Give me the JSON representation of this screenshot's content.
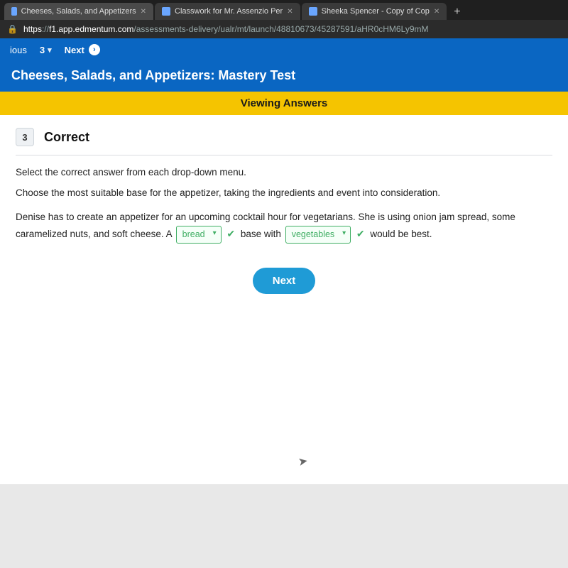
{
  "browser": {
    "tabs": [
      {
        "label": "Cheeses, Salads, and Appetizers"
      },
      {
        "label": "Classwork for Mr. Assenzio Per"
      },
      {
        "label": "Sheeka Spencer - Copy of Cop"
      }
    ],
    "url_scheme": "https",
    "url_host": "f1.app.edmentum.com",
    "url_path": "/assessments-delivery/ualr/mt/launch/48810673/45287591/aHR0cHM6Ly9mM"
  },
  "topbar": {
    "prev_label": "ious",
    "question_number": "3",
    "next_label": "Next"
  },
  "page_title": "Cheeses, Salads, and Appetizers: Mastery Test",
  "banner": "Viewing Answers",
  "question": {
    "number": "3",
    "status": "Correct",
    "instruction": "Select the correct answer from each drop-down menu.",
    "prompt": "Choose the most suitable base for the appetizer, taking the ingredients and event into consideration.",
    "sentence": {
      "part1": "Denise has to create an appetizer for an upcoming cocktail hour for vegetarians. She is using onion jam spread, some caramelized nuts, and soft cheese. A ",
      "dropdown1": "bread",
      "part2": " base with ",
      "dropdown2": "vegetables",
      "part3": " would be best."
    }
  },
  "next_button": "Next"
}
